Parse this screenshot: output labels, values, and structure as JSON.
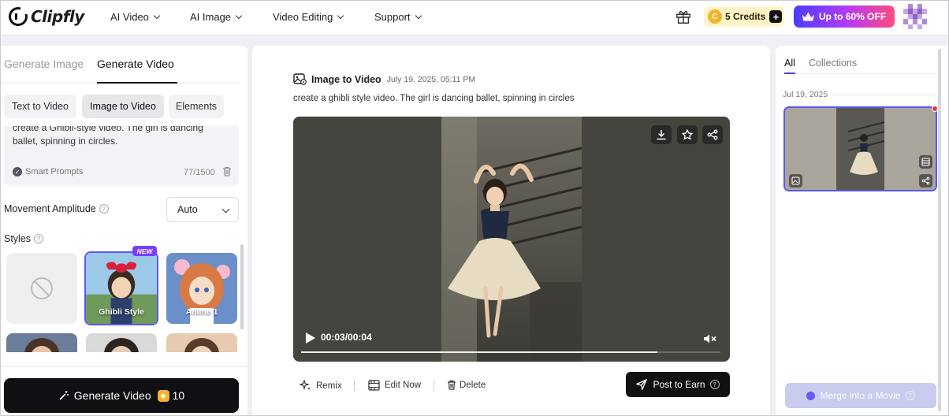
{
  "header": {
    "logo_text": "Clipfly",
    "nav": [
      {
        "label": "AI Video"
      },
      {
        "label": "AI Image"
      },
      {
        "label": "Video Editing"
      },
      {
        "label": "Support"
      }
    ],
    "credits_label": "5 Credits",
    "credits_plus": "+",
    "coin_letter": "C",
    "promo_label": "Up to 60% OFF"
  },
  "left": {
    "tabs": [
      "Generate Image",
      "Generate Video"
    ],
    "active_tab": "Generate Video",
    "subtabs": [
      "Text to Video",
      "Image to Video",
      "Elements"
    ],
    "active_subtab": "Image to Video",
    "prompt_text": "create a Ghibli-style video. The girl is dancing ballet, spinning in circles.",
    "smart_prompts_label": "Smart Prompts",
    "char_count": "77/1500",
    "movement_label": "Movement Amplitude",
    "movement_value": "Auto",
    "styles_label": "Styles",
    "styles": [
      {
        "name": "",
        "type": "none"
      },
      {
        "name": "Ghibli Style",
        "badge": "NEW",
        "selected": true
      },
      {
        "name": "Anime 1"
      }
    ],
    "generate_label": "Generate Video",
    "generate_cost": "10",
    "help_glyph": "?"
  },
  "center": {
    "title": "Image to Video",
    "date": "July 19, 2025, 05:11 PM",
    "prompt": "create a ghibli style video. The girl is dancing ballet, spinning in circles",
    "player": {
      "current_time": "00:03",
      "separator": "/",
      "duration": "00:04",
      "progress": 0.85,
      "muted": true
    },
    "actions": {
      "remix": "Remix",
      "edit": "Edit Now",
      "delete": "Delete",
      "post": "Post to Earn"
    }
  },
  "right": {
    "tabs": [
      "All",
      "Collections"
    ],
    "active_tab": "All",
    "group_date": "Jul 19, 2025",
    "merge_label": "Merge into a Movie"
  },
  "colors": {
    "accent": "#5b58f0",
    "credit_bg": "#fff4c9",
    "promo_start": "#4c3cff",
    "promo_end": "#ff4b7a",
    "new_badge": "#7a3cff"
  }
}
